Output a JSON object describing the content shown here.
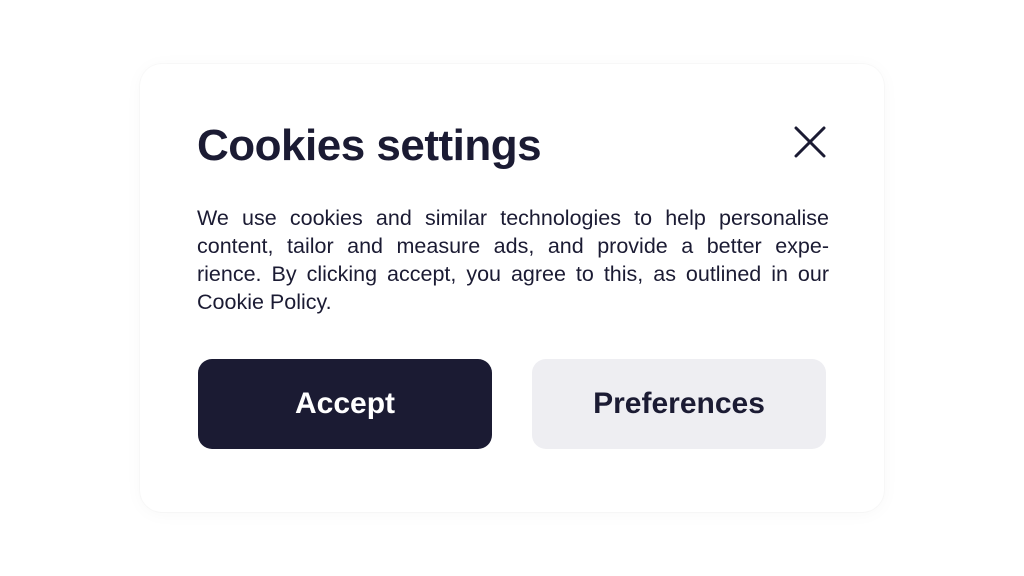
{
  "dialog": {
    "title": "Cookies settings",
    "close_icon": "close-icon",
    "body_lines": [
      "We use cookies and similar technologies to help personalise",
      "content, tailor and measure ads, and provide a better expe-",
      "rience. By clicking accept, you agree to this, as outlined in our",
      "Cookie Policy."
    ],
    "accept_label": "Accept",
    "preferences_label": "Preferences"
  },
  "colors": {
    "primary": "#1b1b33",
    "secondary_button": "#eeeef2",
    "background": "#ffffff"
  }
}
